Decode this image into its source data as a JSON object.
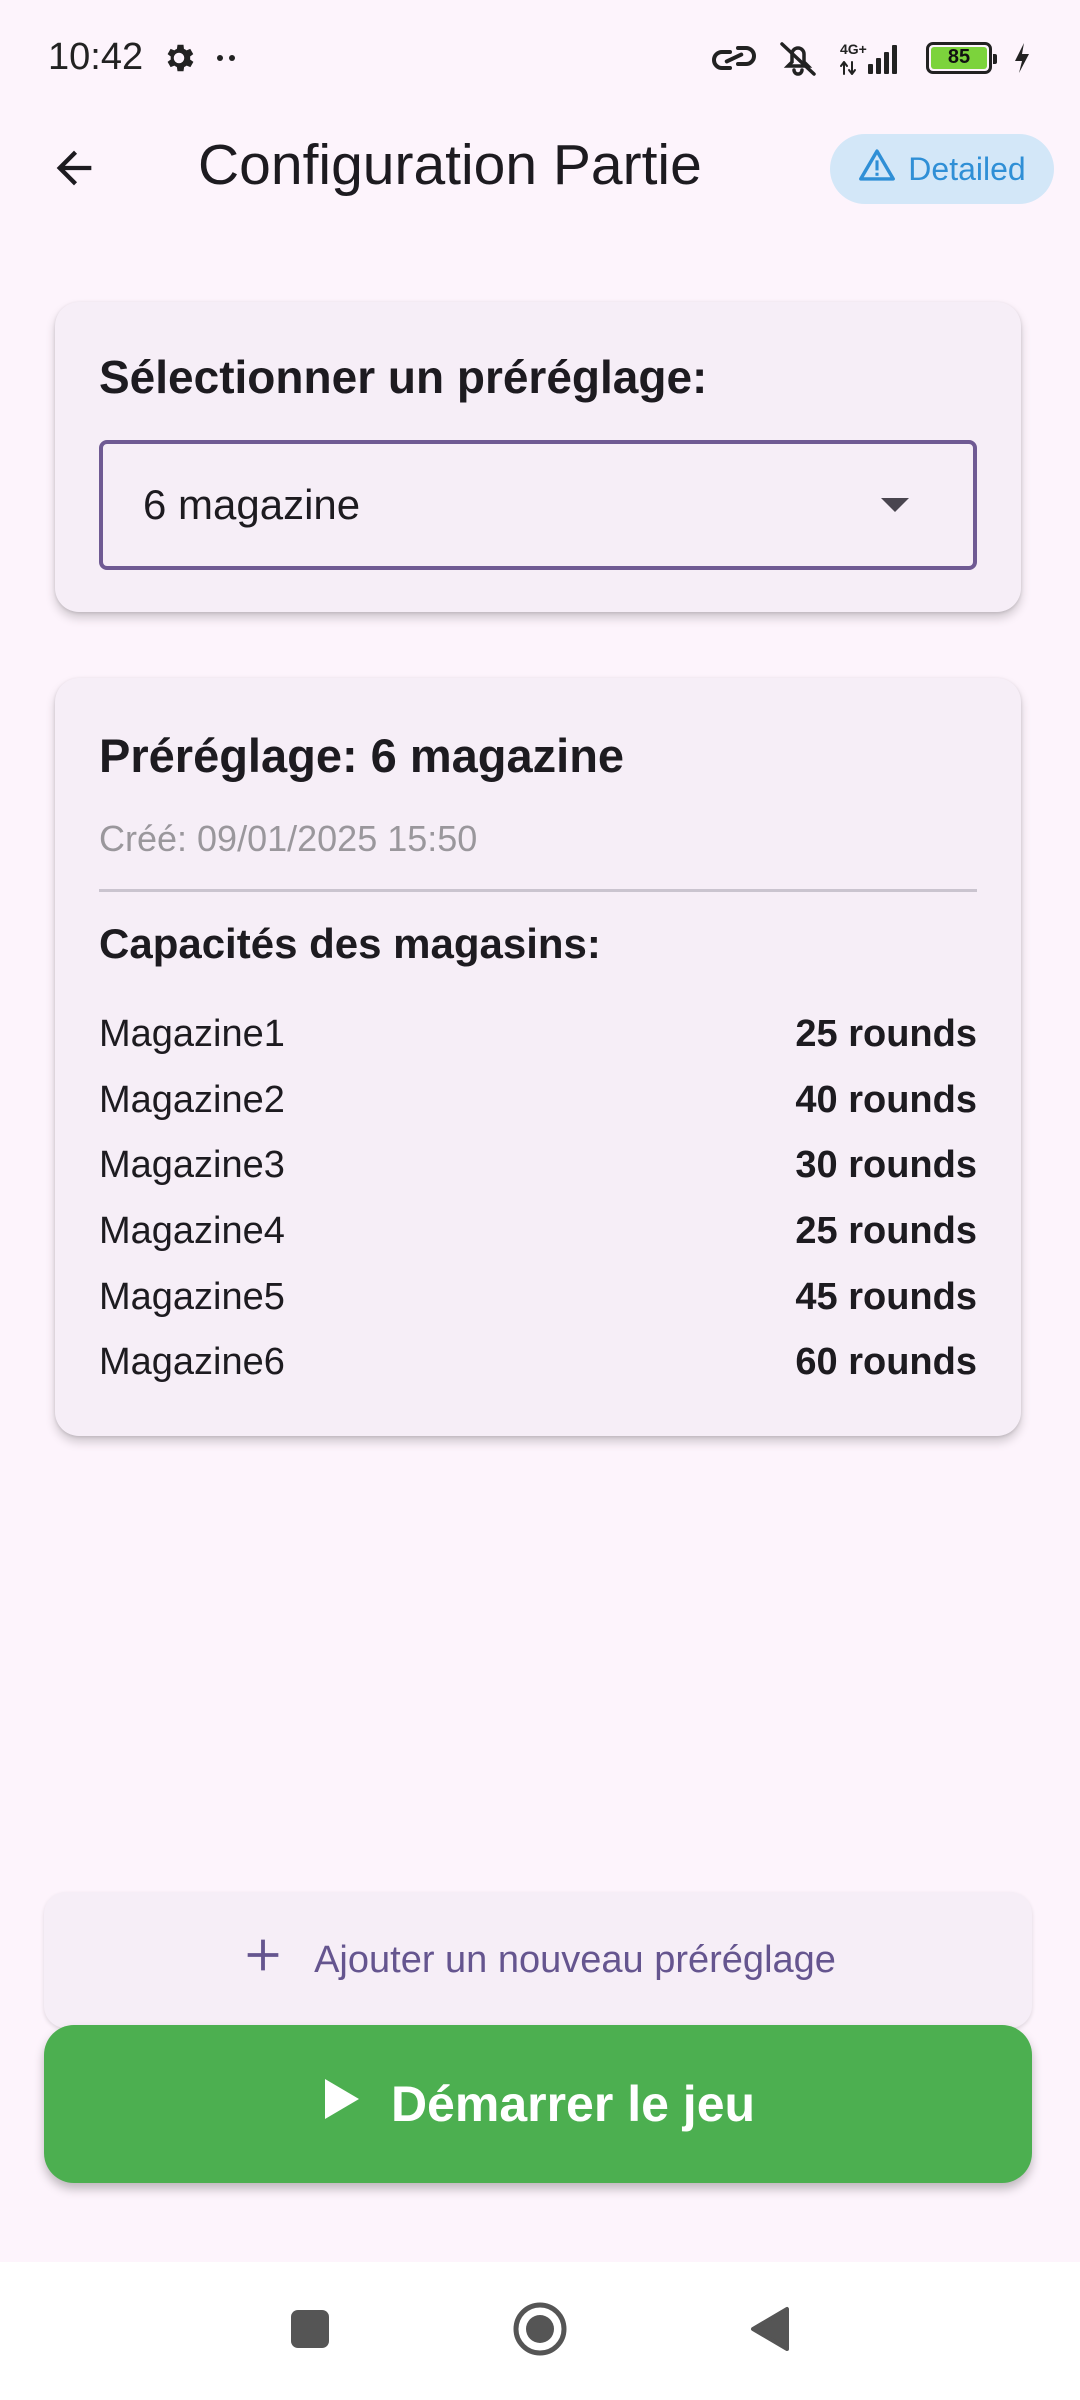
{
  "status_bar": {
    "time": "10:42",
    "network_label": "4G+",
    "battery_level": "85",
    "battery_color": "#7CD33C",
    "icons": [
      "settings-gear-icon",
      "more-dots-icon",
      "link-icon",
      "vibrate-off-icon",
      "signal-icon",
      "battery-icon",
      "charging-icon"
    ]
  },
  "app_bar": {
    "back_icon": "arrow-back-icon",
    "title": "Configuration Partie",
    "badge": {
      "icon": "warning-triangle-icon",
      "label": "Detailed",
      "color": "#2F8FD6"
    }
  },
  "preset_selector": {
    "title": "Sélectionner un préréglage:",
    "selected": "6 magazine"
  },
  "preset_details": {
    "title": "Préréglage: 6 magazine",
    "created": "Créé: 09/01/2025 15:50",
    "capacities_title": "Capacités des magasins:",
    "magazines": [
      {
        "name": "Magazine1",
        "value": "25 rounds"
      },
      {
        "name": "Magazine2",
        "value": "40 rounds"
      },
      {
        "name": "Magazine3",
        "value": "30 rounds"
      },
      {
        "name": "Magazine4",
        "value": "25 rounds"
      },
      {
        "name": "Magazine5",
        "value": "45 rounds"
      },
      {
        "name": "Magazine6",
        "value": "60 rounds"
      }
    ]
  },
  "actions": {
    "add_label": "Ajouter un nouveau préréglage",
    "start_label": "Démarrer le jeu",
    "start_color": "#4CAF50"
  },
  "nav_bar": {
    "icons": [
      "recents-square-icon",
      "home-circle-icon",
      "back-triangle-icon"
    ]
  }
}
